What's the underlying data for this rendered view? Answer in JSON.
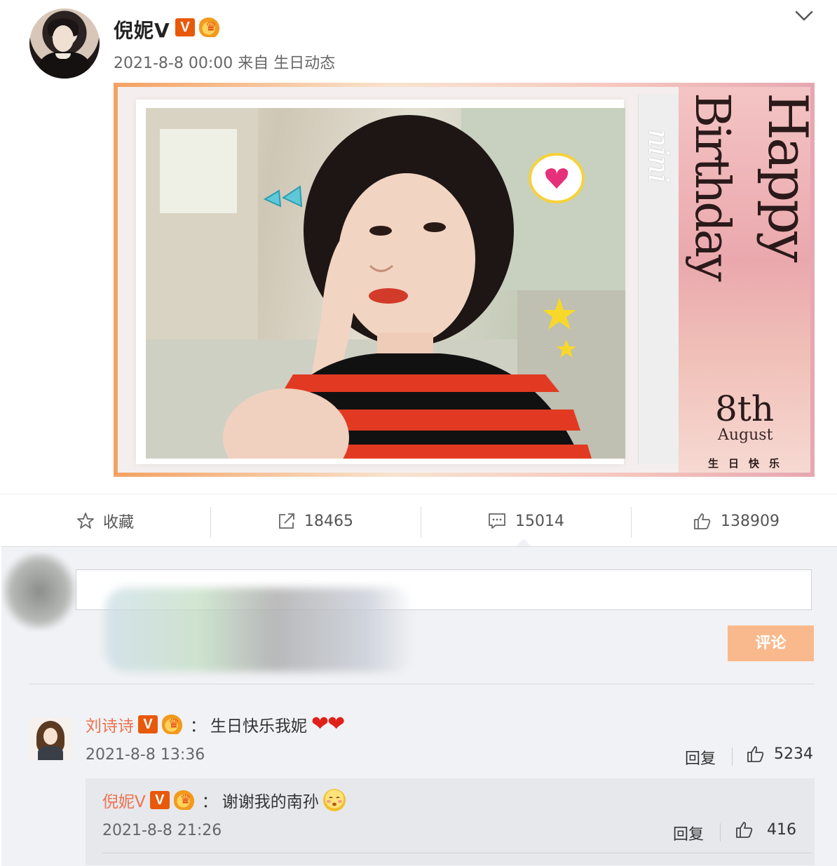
{
  "post": {
    "author": "倪妮V",
    "badge_v": "V",
    "timestamp": "2021-8-8 00:00",
    "source_prefix": "来自",
    "source": "生日动态",
    "image": {
      "title_line1": "Happy",
      "title_line2": "Birthday",
      "date_day": "8th",
      "date_month": "August",
      "date_cn": "生日快乐",
      "signature": "nini"
    }
  },
  "actions": {
    "favorite_label": "收藏",
    "repost_count": "18465",
    "comment_count": "15014",
    "like_count": "138909"
  },
  "composer": {
    "input_placeholder": "",
    "submit_label": "评论"
  },
  "comments": [
    {
      "author": "刘诗诗",
      "badge_v": "V",
      "separator": "：",
      "text": "生日快乐我妮",
      "emoji": "❤❤",
      "time": "2021-8-8 13:36",
      "reply_label": "回复",
      "likes": "5234",
      "reply": {
        "author": "倪妮V",
        "badge_v": "V",
        "separator": "：",
        "text": "谢谢我的南孙",
        "time": "2021-8-8 21:26",
        "reply_label": "回复",
        "likes": "416"
      }
    }
  ],
  "colors": {
    "accent": "#eb7350",
    "submit_bg": "#f9b98c",
    "badge_bg": "#e8590c"
  }
}
